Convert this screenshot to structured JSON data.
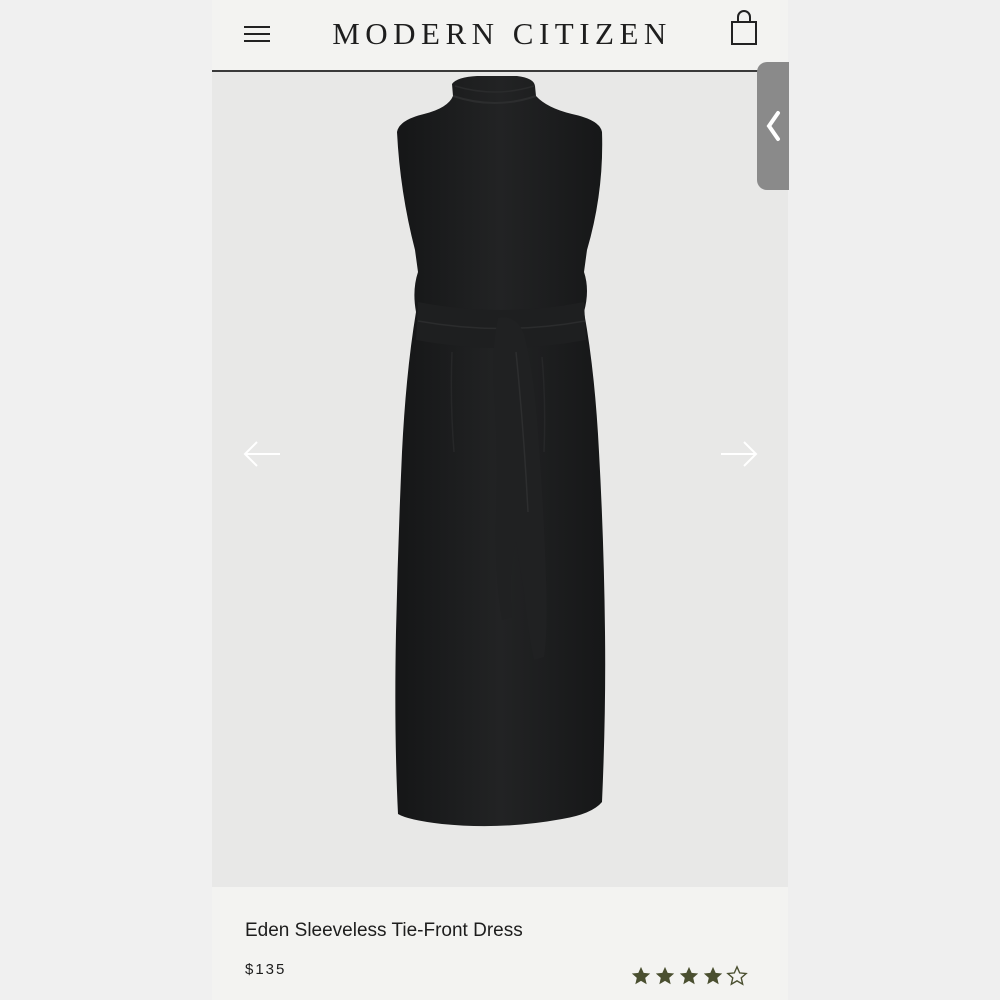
{
  "header": {
    "brand": "MODERN CITIZEN",
    "menu_icon": "hamburger-menu-icon",
    "cart_icon": "shopping-bag-icon"
  },
  "gallery": {
    "image_alt": "Black sleeveless mock-neck midi dress with tie belt",
    "prev_icon": "arrow-left-icon",
    "next_icon": "arrow-right-icon"
  },
  "drawer": {
    "icon": "chevron-left-icon"
  },
  "product": {
    "name": "Eden Sleeveless Tie-Front Dress",
    "price": "$135",
    "rating": 4,
    "rating_max": 5
  },
  "colors": {
    "header_bg": "#f3f3f1",
    "image_bg": "#e8e8e7",
    "dress": "#1b1c1d",
    "star": "#4a4f30",
    "drawer": "#8a8a8a"
  }
}
